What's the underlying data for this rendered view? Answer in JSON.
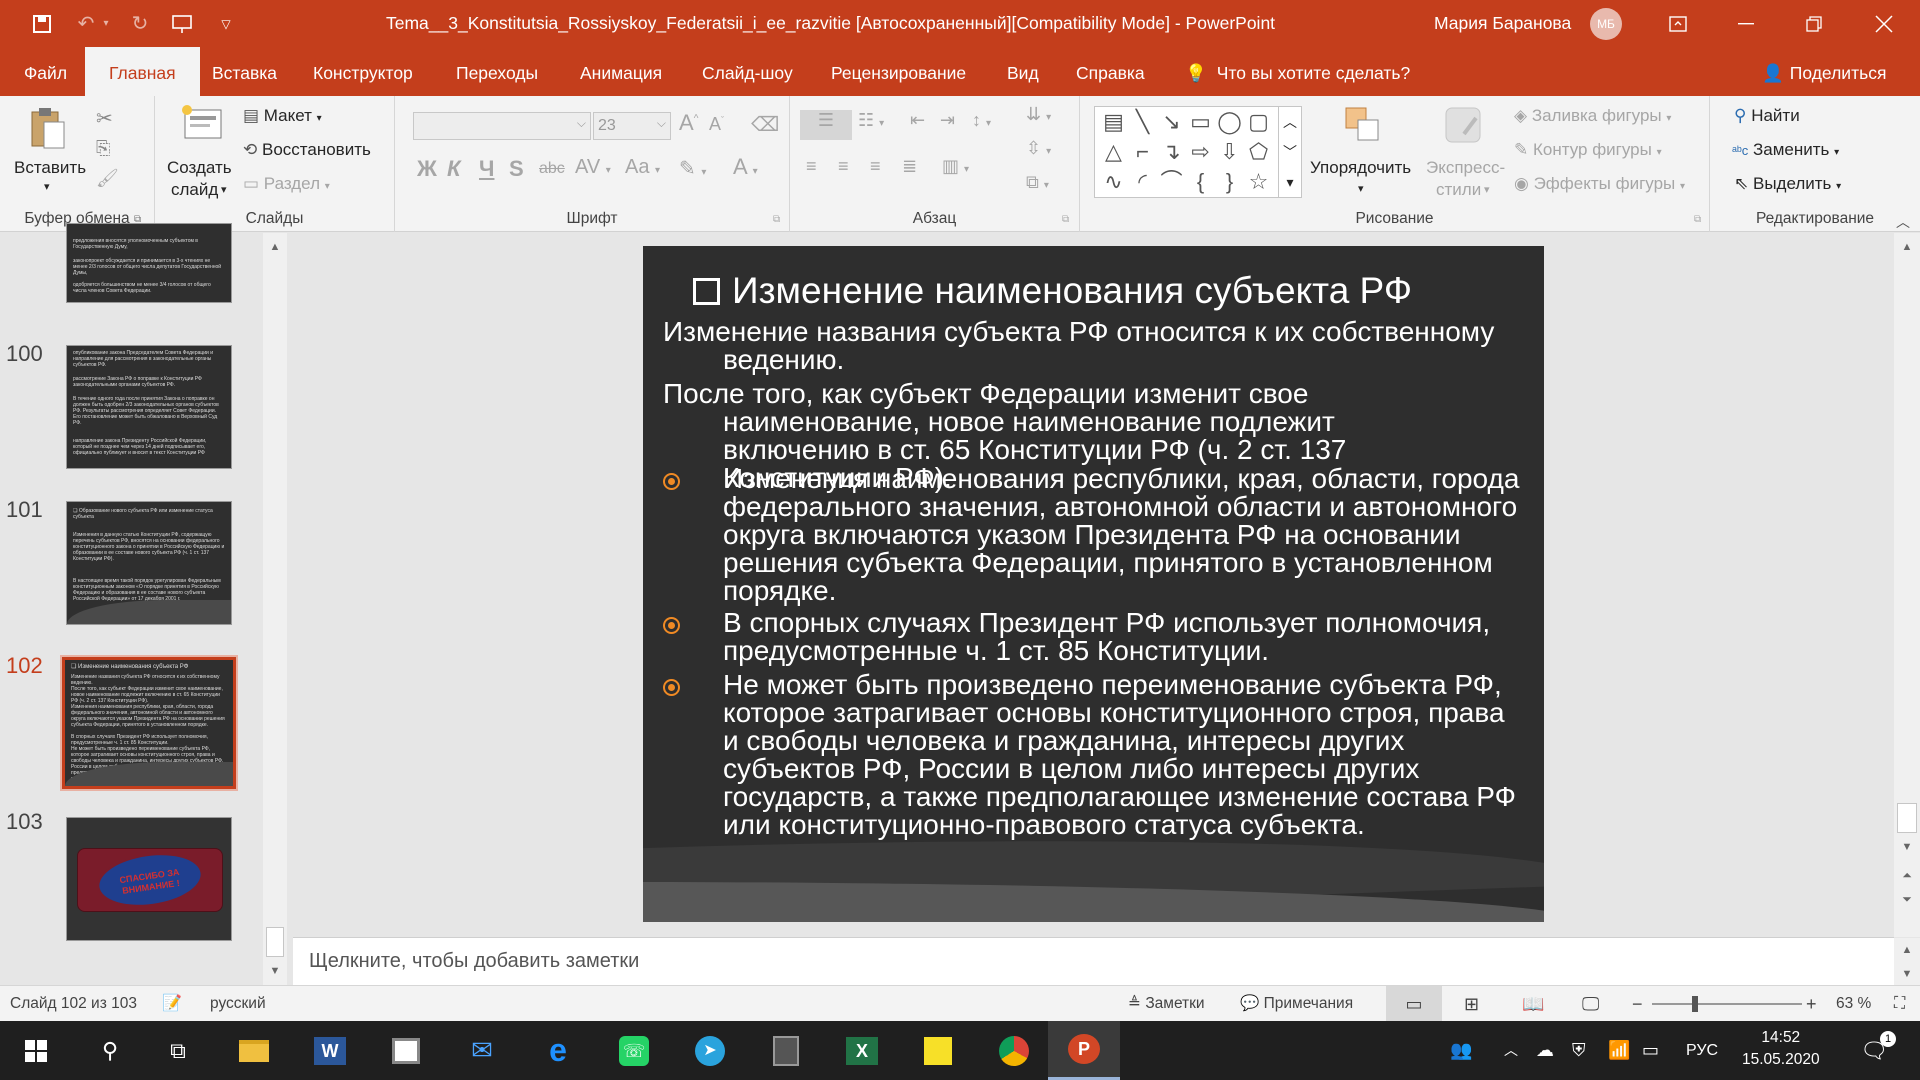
{
  "window": {
    "title": "Tema__3_Konstitutsia_Rossiyskoy_Federatsii_i_ee_razvitie [Автосохраненный][Compatibility Mode]  -  PowerPoint",
    "user": "Мария Баранова",
    "avatar_initials": "МБ"
  },
  "tabs": [
    "Файл",
    "Главная",
    "Вставка",
    "Конструктор",
    "Переходы",
    "Анимация",
    "Слайд-шоу",
    "Рецензирование",
    "Вид",
    "Справка"
  ],
  "search_text": "Что вы хотите сделать?",
  "share_label": "Поделиться",
  "ribbon": {
    "clipboard": {
      "paste": "Вставить",
      "label": "Буфер обмена"
    },
    "slides": {
      "new_slide_1": "Создать",
      "new_slide_2": "слайд",
      "layout": "Макет",
      "reset": "Восстановить",
      "section": "Раздел",
      "label": "Слайды"
    },
    "font": {
      "size": "23",
      "label": "Шрифт",
      "bold": "Ж",
      "italic": "К",
      "underline": "Ч",
      "strike": "S",
      "aa": "Aa",
      "grow": "A",
      "shrink": "A",
      "color": "A",
      "av": "AV",
      "abc": "abc"
    },
    "paragraph": {
      "label": "Абзац"
    },
    "drawing": {
      "arrange_1": "Упорядочить",
      "styles_1": "Экспресс-",
      "styles_2": "стили",
      "fill": "Заливка фигуры",
      "outline": "Контур фигуры",
      "effects": "Эффекты фигуры",
      "label": "Рисование"
    },
    "editing": {
      "find": "Найти",
      "replace": "Заменить",
      "select": "Выделить",
      "label": "Редактирование"
    }
  },
  "thumbnails": [
    {
      "num": "",
      "lines": [
        "предложения вносятся уполномоченным субъектом в Государственную Думу,",
        "законопроект обсуждается и принимается в 3-х чтениях не менее 2/3 голосов от общего числа депутатов Государственной Думы,",
        "одобряется большинством не менее 3/4 голосов от общего числа членов Совета Федерации."
      ]
    },
    {
      "num": "100",
      "lines": [
        "опубликование закона Председателем Совета Федерации и направление для рассмотрения в законодательные органы субъектов РФ.",
        "рассмотрение Закона РФ о поправке к Конституции РФ законодательными органами субъектов РФ.",
        "В течение одного года после принятия Закона о поправке он должен быть одобрен 2/3 законодательных органов субъектов РФ. Результаты рассмотрения определяет Совет Федерации. Его постановление может быть обжаловано в Верховный Суд РФ.",
        "направление закона Президенту Российской Федерации, который не позднее чем через 14 дней подписывает его, официально публикует и вносит в текст Конституции РФ"
      ]
    },
    {
      "num": "101",
      "lines": [
        "❏ Образование нового субъекта РФ или изменение статуса субъекта",
        "Изменения в данную статью Конституции РФ, содержащую перечень субъектов РФ, вносятся на основании федерального конституционного закона о принятии в Российскую Федерацию и образовании в ее составе нового субъекта РФ (ч. 1 ст. 137 Конституции РФ).",
        "В настоящее время такой порядок урегулирован Федеральным конституционным законом «О порядке принятия в Российскую Федерацию и образования в ее составе нового субъекта Российской Федерации» от 17 декабря 2001 г."
      ]
    },
    {
      "num": "102",
      "lines": [
        "❏ Изменение наименования субъекта РФ",
        "Изменение названия субъекта РФ относится к их собственному ведению.",
        "После того, как субъект Федерации изменит свое наименование, новое наименование подлежит включению в ст. 65 Конституции РФ (ч. 2 ст. 137 Конституции РФ).",
        "Изменения наименования республики, края, области, города федерального значения, автономной области и автономного округа включаются указом Президента РФ на основании решения субъекта Федерации, принятого в установленном порядке.",
        "В спорных случаях Президент РФ использует полномочия, предусмотренные ч. 1 ст. 85 Конституции.",
        "Не может быть произведено переименование субъекта РФ, которое затрагивает основы конституционного строя, права и свободы человека и гражданина, интересы других субъектов РФ, России в целом либо интересы других государств, а также предполагающее изменение состава РФ или конституционно-правового статуса субъекта."
      ]
    },
    {
      "num": "103",
      "lines": [
        "СПАСИБО ЗА ВНИМАНИЕ !"
      ]
    }
  ],
  "slide": {
    "title": "Изменение наименования субъекта РФ",
    "paragraphs": [
      {
        "first": "Изменение названия субъекта РФ относится к их собственному",
        "rest": "ведению."
      },
      {
        "first": "После того, как субъект Федерации изменит свое",
        "rest": "наименование, новое наименование подлежит включению в ст. 65 Конституции РФ (ч. 2 ст. 137 Конституции РФ)."
      }
    ],
    "bullets": [
      "Изменения наименования республики, края, области, города федерального значения, автономной области и автономного округа включаются указом Президента РФ на основании решения субъекта Федерации, принятого в установленном порядке.",
      "В спорных случаях Президент РФ использует полномочия, предусмотренные ч. 1 ст. 85 Конституции.",
      "Не может быть произведено переименование субъекта РФ, которое затрагивает основы конституционного строя, права и свободы человека и гражданина, интересы других субъектов РФ, России в целом либо интересы других государств, а также предполагающее изменение состава РФ или конституционно-правового статуса субъекта."
    ]
  },
  "notes_placeholder": "Щелкните, чтобы добавить заметки",
  "status": {
    "slide_info": "Слайд 102 из 103",
    "language": "русский",
    "notes": "Заметки",
    "comments": "Примечания",
    "zoom": "63 %"
  },
  "taskbar": {
    "time": "14:52",
    "date": "15.05.2020",
    "lang": "РУС",
    "notification_count": "1"
  },
  "colors": {
    "accent": "#c43e1c",
    "bullet": "#f08a24",
    "slide_bg": "#2e2e2e"
  }
}
